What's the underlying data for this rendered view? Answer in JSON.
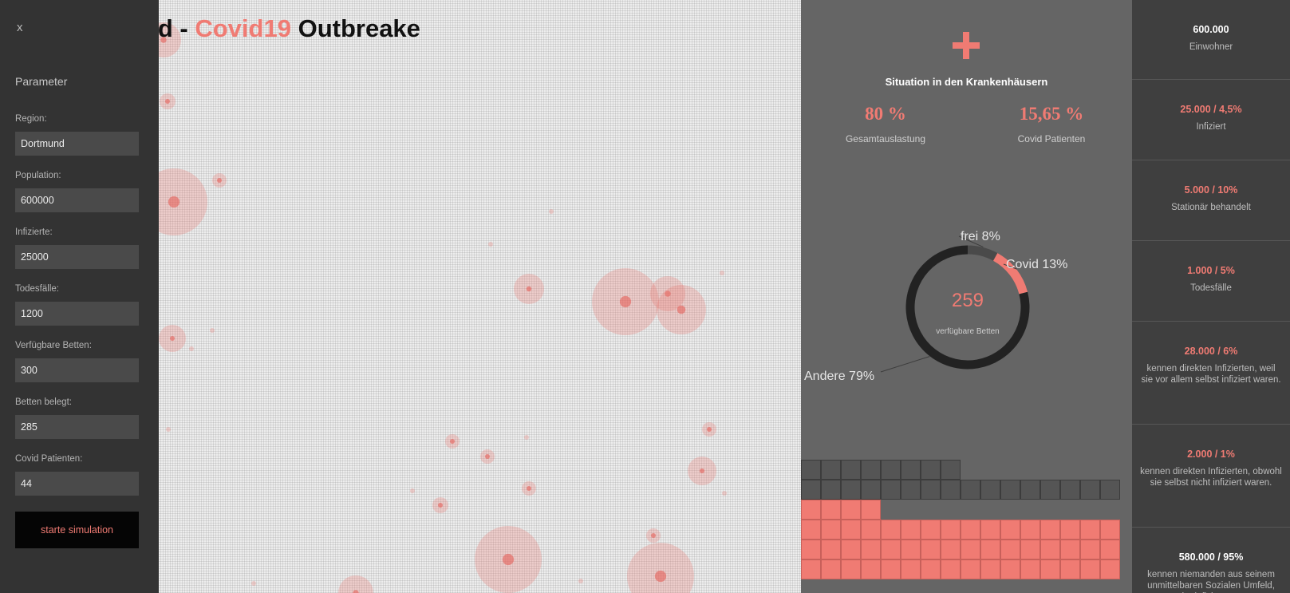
{
  "title": {
    "prefix": "und - ",
    "accent": "Covid19",
    "suffix": " Outbreake"
  },
  "sidebar": {
    "close_label": "x",
    "heading": "Parameter",
    "fields": [
      {
        "label": "Region:",
        "value": "Dortmund"
      },
      {
        "label": "Population:",
        "value": "600000"
      },
      {
        "label": "Infizierte:",
        "value": "25000"
      },
      {
        "label": "Todesfälle:",
        "value": "1200"
      },
      {
        "label": "Verfügbare Betten:",
        "value": "300"
      },
      {
        "label": "Betten belegt:",
        "value": "285"
      },
      {
        "label": "Covid Patienten:",
        "value": "44"
      }
    ],
    "start_button": "starte simulation"
  },
  "hospital": {
    "icon": "plus-icon",
    "title": "Situation in den Krankenhäusern",
    "stats": [
      {
        "value": "80 %",
        "label": "Gesamtauslastung"
      },
      {
        "value": "15,65 %",
        "label": "Covid Patienten"
      }
    ],
    "donut": {
      "center_value": "259",
      "center_label": "verfügbare Betten",
      "segments": [
        {
          "label": "frei 8%",
          "percent": 8,
          "color": "#4a4a4a"
        },
        {
          "label": "Covid 13%",
          "percent": 13,
          "color": "#f07b73"
        },
        {
          "label": "Andere 79%",
          "percent": 79,
          "color": "#222222"
        }
      ]
    },
    "waffle_rows": [
      {
        "color": "#555555",
        "count": 8
      },
      {
        "color": "#555555",
        "count": 16
      },
      {
        "color": "#f07b73",
        "count": 4
      },
      {
        "color": "#f07b73",
        "count": 16
      },
      {
        "color": "#f07b73",
        "count": 16
      },
      {
        "color": "#f07b73",
        "count": 16
      }
    ]
  },
  "stats_panel": [
    {
      "value": "600.000",
      "label": "Einwohner",
      "highlight": false
    },
    {
      "value": "25.000 / 4,5%",
      "label": "Infiziert",
      "highlight": true
    },
    {
      "value": "5.000 / 10%",
      "label": "Stationär behandelt",
      "highlight": true
    },
    {
      "value": "1.000 / 5%",
      "label": "Todesfälle",
      "highlight": true
    },
    {
      "value": "28.000 / 6%",
      "label": "kennen direkten Infizierten, weil sie vor allem selbst infiziert waren.",
      "highlight": true
    },
    {
      "value": "2.000 / 1%",
      "label": "kennen direkten Infizierten, obwohl sie selbst nicht infiziert waren.",
      "highlight": true
    },
    {
      "value": "580.000 / 95%",
      "label": "kennen niemanden aus seinem unmittelbaren Sozialen Umfeld, der infiziert war.",
      "highlight": false
    }
  ],
  "colors": {
    "accent": "#f07b73",
    "sidebar_bg": "#333333",
    "panel_bg": "#656565",
    "right_bg": "#3f3f3f"
  }
}
